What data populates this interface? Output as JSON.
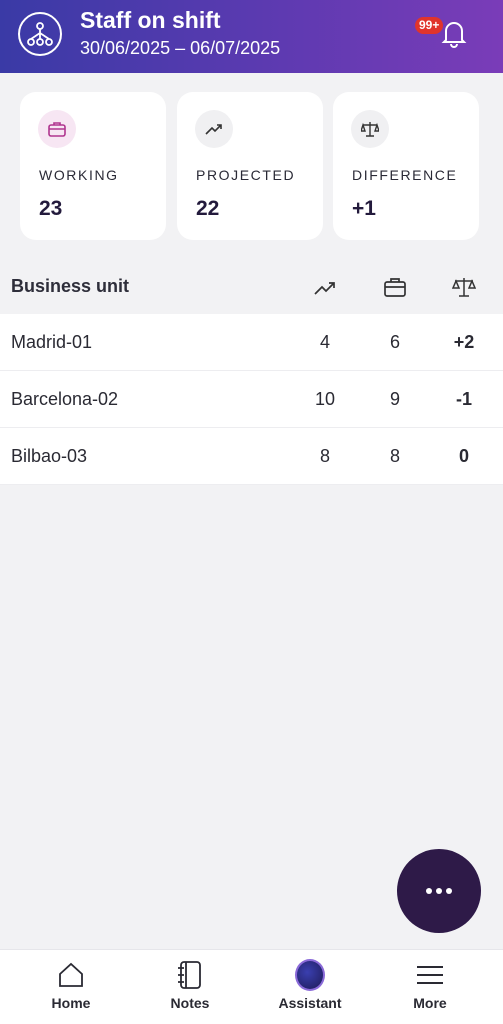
{
  "header": {
    "title": "Staff on shift",
    "dates": "30/06/2025 – 06/07/2025",
    "badge": "99+",
    "logo_icon": "org-chart-icon",
    "bell_icon": "bell-icon"
  },
  "cards": [
    {
      "label": "WORKING",
      "value": "23",
      "icon": "briefcase-icon"
    },
    {
      "label": "PROJECTED",
      "value": "22",
      "icon": "trending-up-icon"
    },
    {
      "label": "DIFFERENCE",
      "value": "+1",
      "icon": "scale-icon"
    }
  ],
  "table": {
    "column_title": "Business unit",
    "header_icons": [
      "trending-up-icon",
      "briefcase-icon",
      "scale-icon"
    ],
    "rows": [
      {
        "unit": "Madrid-01",
        "projected": "4",
        "working": "6",
        "difference": "+2"
      },
      {
        "unit": "Barcelona-02",
        "projected": "10",
        "working": "9",
        "difference": "-1"
      },
      {
        "unit": "Bilbao-03",
        "projected": "8",
        "working": "8",
        "difference": "0"
      }
    ]
  },
  "fab": {
    "icon": "more-horizontal-icon"
  },
  "nav": [
    {
      "label": "Home",
      "icon": "home-icon"
    },
    {
      "label": "Notes",
      "icon": "notebook-icon"
    },
    {
      "label": "Assistant",
      "icon": "assistant-avatar-icon"
    },
    {
      "label": "More",
      "icon": "menu-icon"
    }
  ],
  "colors": {
    "header_start": "#3a3aa6",
    "header_end": "#7a3cb8",
    "fab": "#2e1a48",
    "badge": "#e0342c",
    "background": "#f2f2f4"
  }
}
